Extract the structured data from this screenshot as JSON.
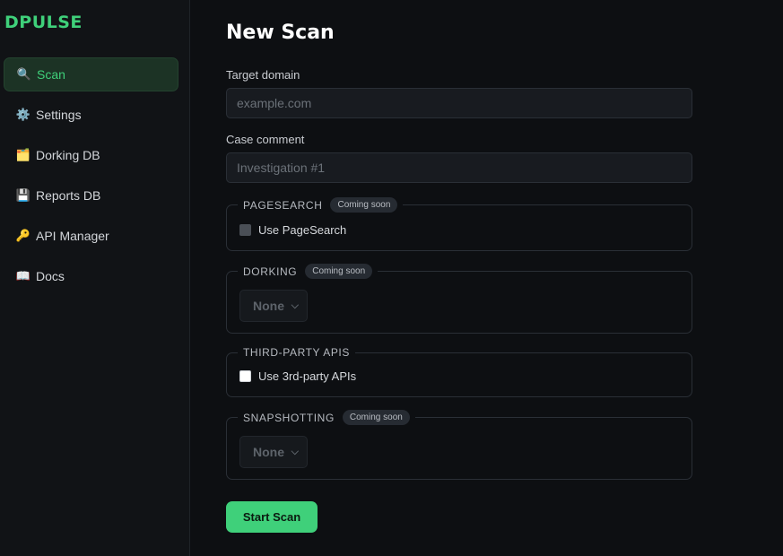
{
  "brand": "DPULSE",
  "sidebar": {
    "items": [
      {
        "label": "Scan",
        "icon": "🔍",
        "icon_name": "magnifier-icon",
        "active": true
      },
      {
        "label": "Settings",
        "icon": "⚙️",
        "icon_name": "gear-icon",
        "active": false
      },
      {
        "label": "Dorking DB",
        "icon": "🗂️",
        "icon_name": "folder-icon",
        "active": false
      },
      {
        "label": "Reports DB",
        "icon": "💾",
        "icon_name": "floppy-disk-icon",
        "active": false
      },
      {
        "label": "API Manager",
        "icon": "🔑",
        "icon_name": "key-icon",
        "active": false
      },
      {
        "label": "Docs",
        "icon": "📖",
        "icon_name": "book-icon",
        "active": false
      }
    ]
  },
  "main": {
    "title": "New Scan",
    "target": {
      "label": "Target domain",
      "placeholder": "example.com"
    },
    "comment": {
      "label": "Case comment",
      "placeholder": "Investigation #1"
    },
    "pagesearch": {
      "legend": "PAGESEARCH",
      "badge": "Coming soon",
      "checkbox_label": "Use PageSearch"
    },
    "dorking": {
      "legend": "DORKING",
      "badge": "Coming soon",
      "selected": "None"
    },
    "third_party": {
      "legend": "THIRD-PARTY APIS",
      "checkbox_label": "Use 3rd-party APIs"
    },
    "snapshotting": {
      "legend": "SNAPSHOTTING",
      "badge": "Coming soon",
      "selected": "None"
    },
    "start_label": "Start Scan"
  },
  "colors": {
    "accent": "#3fd07a",
    "background": "#0d0f12",
    "sidebar": "#111316"
  }
}
